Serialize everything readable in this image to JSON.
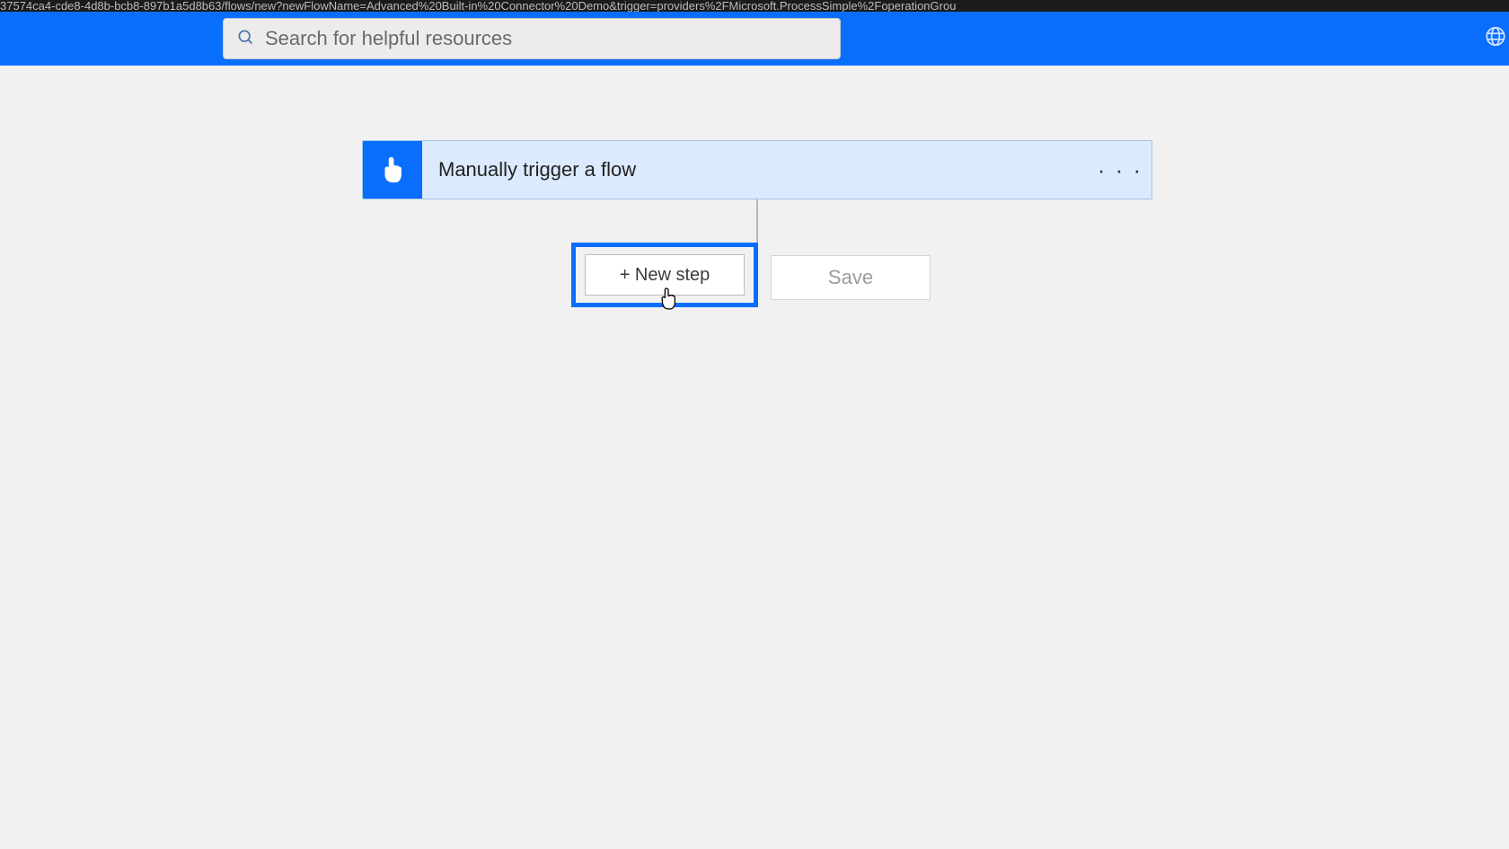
{
  "url": "37574ca4-cde8-4d8b-bcb8-897b1a5d8b63/flows/new?newFlowName=Advanced%20Built-in%20Connector%20Demo&trigger=providers%2FMicrosoft.ProcessSimple%2FoperationGrou",
  "search": {
    "placeholder": "Search for helpful resources"
  },
  "trigger": {
    "title": "Manually trigger a flow",
    "more": "· · ·"
  },
  "buttons": {
    "newStep": "+ New step",
    "save": "Save"
  }
}
